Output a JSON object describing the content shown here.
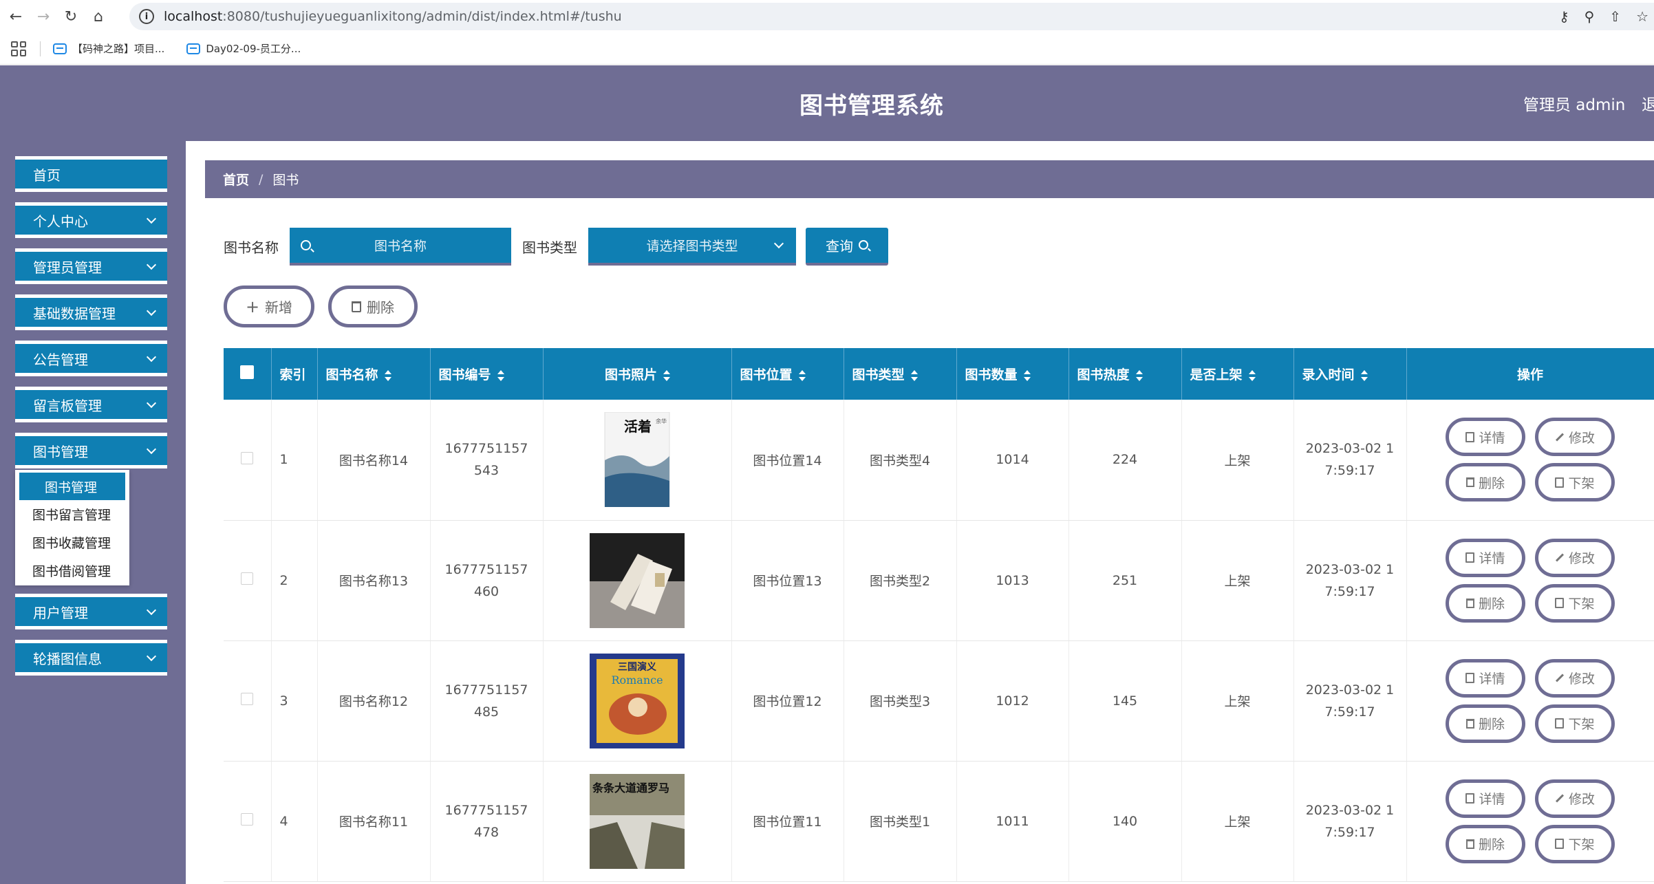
{
  "browser": {
    "url_host": "localhost",
    "url_path": ":8080/tushujieyueguanlixitong/admin/dist/index.html#/tushu",
    "bookmarks": [
      "【码神之路】项目...",
      "Day02-09-员工分..."
    ]
  },
  "header": {
    "title": "图书管理系统",
    "admin_label": "管理员 admin",
    "logout_label": "退"
  },
  "sidebar": {
    "items": [
      {
        "label": "首页"
      },
      {
        "label": "个人中心"
      },
      {
        "label": "管理员管理"
      },
      {
        "label": "基础数据管理"
      },
      {
        "label": "公告管理"
      },
      {
        "label": "留言板管理"
      },
      {
        "label": "图书管理"
      },
      {
        "label": "用户管理"
      },
      {
        "label": "轮播图信息"
      }
    ],
    "submenu": [
      "图书管理",
      "图书留言管理",
      "图书收藏管理",
      "图书借阅管理"
    ]
  },
  "breadcrumb": {
    "home": "首页",
    "sep": "/",
    "current": "图书"
  },
  "search": {
    "name_label": "图书名称",
    "name_placeholder": "图书名称",
    "type_label": "图书类型",
    "type_placeholder": "请选择图书类型",
    "query_label": "查询"
  },
  "actions": {
    "add_label": "新增",
    "delete_label": "删除"
  },
  "table": {
    "headers": [
      "索引",
      "图书名称",
      "图书编号",
      "图书照片",
      "图书位置",
      "图书类型",
      "图书数量",
      "图书热度",
      "是否上架",
      "录入时间",
      "操作"
    ],
    "rows": [
      {
        "index": "1",
        "name": "图书名称14",
        "code": "1677751157543",
        "location": "图书位置14",
        "type": "图书类型4",
        "count": "1014",
        "heat": "224",
        "shelf": "上架",
        "time": "2023-03-02 17:59:17"
      },
      {
        "index": "2",
        "name": "图书名称13",
        "code": "1677751157460",
        "location": "图书位置13",
        "type": "图书类型2",
        "count": "1013",
        "heat": "251",
        "shelf": "上架",
        "time": "2023-03-02 17:59:17"
      },
      {
        "index": "3",
        "name": "图书名称12",
        "code": "1677751157485",
        "location": "图书位置12",
        "type": "图书类型3",
        "count": "1012",
        "heat": "145",
        "shelf": "上架",
        "time": "2023-03-02 17:59:17"
      },
      {
        "index": "4",
        "name": "图书名称11",
        "code": "1677751157478",
        "location": "图书位置11",
        "type": "图书类型1",
        "count": "1011",
        "heat": "140",
        "shelf": "上架",
        "time": "2023-03-02 17:59:17"
      }
    ],
    "op_labels": {
      "detail": "详情",
      "edit": "修改",
      "delete": "删除",
      "unshelf": "下架"
    },
    "cover_texts": [
      "活着",
      "余华",
      "三国演义",
      "Romance",
      "条条大道通罗马"
    ]
  },
  "colors": {
    "primary": "#0f7fb3",
    "accent": "#6f6d94"
  }
}
